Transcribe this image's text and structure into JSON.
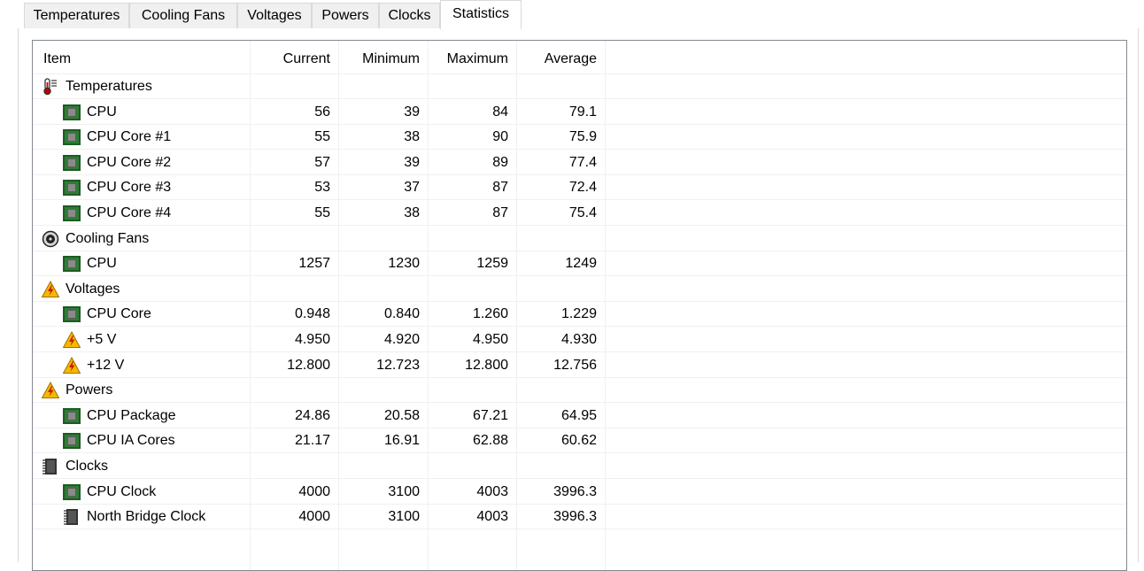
{
  "tabs": [
    "Temperatures",
    "Cooling Fans",
    "Voltages",
    "Powers",
    "Clocks",
    "Statistics"
  ],
  "columns": [
    "Item",
    "Current",
    "Minimum",
    "Maximum",
    "Average"
  ],
  "rows": [
    {
      "label": "Temperatures",
      "icon": "thermometer-icon",
      "current": "",
      "minimum": "",
      "maximum": "",
      "average": ""
    },
    {
      "label": "CPU",
      "icon": "cpu-chip-icon",
      "current": "56",
      "minimum": "39",
      "maximum": "84",
      "average": "79.1"
    },
    {
      "label": "CPU Core #1",
      "icon": "cpu-chip-icon",
      "current": "55",
      "minimum": "38",
      "maximum": "90",
      "average": "75.9"
    },
    {
      "label": "CPU Core #2",
      "icon": "cpu-chip-icon",
      "current": "57",
      "minimum": "39",
      "maximum": "89",
      "average": "77.4"
    },
    {
      "label": "CPU Core #3",
      "icon": "cpu-chip-icon",
      "current": "53",
      "minimum": "37",
      "maximum": "87",
      "average": "72.4"
    },
    {
      "label": "CPU Core #4",
      "icon": "cpu-chip-icon",
      "current": "55",
      "minimum": "38",
      "maximum": "87",
      "average": "75.4"
    },
    {
      "label": "Cooling Fans",
      "icon": "fan-icon",
      "current": "",
      "minimum": "",
      "maximum": "",
      "average": ""
    },
    {
      "label": "CPU",
      "icon": "cpu-chip-icon",
      "current": "1257",
      "minimum": "1230",
      "maximum": "1259",
      "average": "1249"
    },
    {
      "label": "Voltages",
      "icon": "warning-voltage-icon",
      "current": "",
      "minimum": "",
      "maximum": "",
      "average": ""
    },
    {
      "label": "CPU Core",
      "icon": "cpu-chip-icon",
      "current": "0.948",
      "minimum": "0.840",
      "maximum": "1.260",
      "average": "1.229"
    },
    {
      "label": "+5 V",
      "icon": "warning-voltage-icon",
      "current": "4.950",
      "minimum": "4.920",
      "maximum": "4.950",
      "average": "4.930"
    },
    {
      "label": "+12 V",
      "icon": "warning-voltage-icon",
      "current": "12.800",
      "minimum": "12.723",
      "maximum": "12.800",
      "average": "12.756"
    },
    {
      "label": "Powers",
      "icon": "warning-voltage-icon",
      "current": "",
      "minimum": "",
      "maximum": "",
      "average": ""
    },
    {
      "label": "CPU Package",
      "icon": "cpu-chip-icon",
      "current": "24.86",
      "minimum": "20.58",
      "maximum": "67.21",
      "average": "64.95"
    },
    {
      "label": "CPU IA Cores",
      "icon": "cpu-chip-icon",
      "current": "21.17",
      "minimum": "16.91",
      "maximum": "62.88",
      "average": "60.62"
    },
    {
      "label": "Clocks",
      "icon": "memory-chip-icon",
      "current": "",
      "minimum": "",
      "maximum": "",
      "average": ""
    },
    {
      "label": "CPU Clock",
      "icon": "cpu-chip-icon",
      "current": "4000",
      "minimum": "3100",
      "maximum": "4003",
      "average": "3996.3"
    },
    {
      "label": "North Bridge Clock",
      "icon": "memory-chip-icon",
      "current": "4000",
      "minimum": "3100",
      "maximum": "4003",
      "average": "3996.3"
    }
  ]
}
